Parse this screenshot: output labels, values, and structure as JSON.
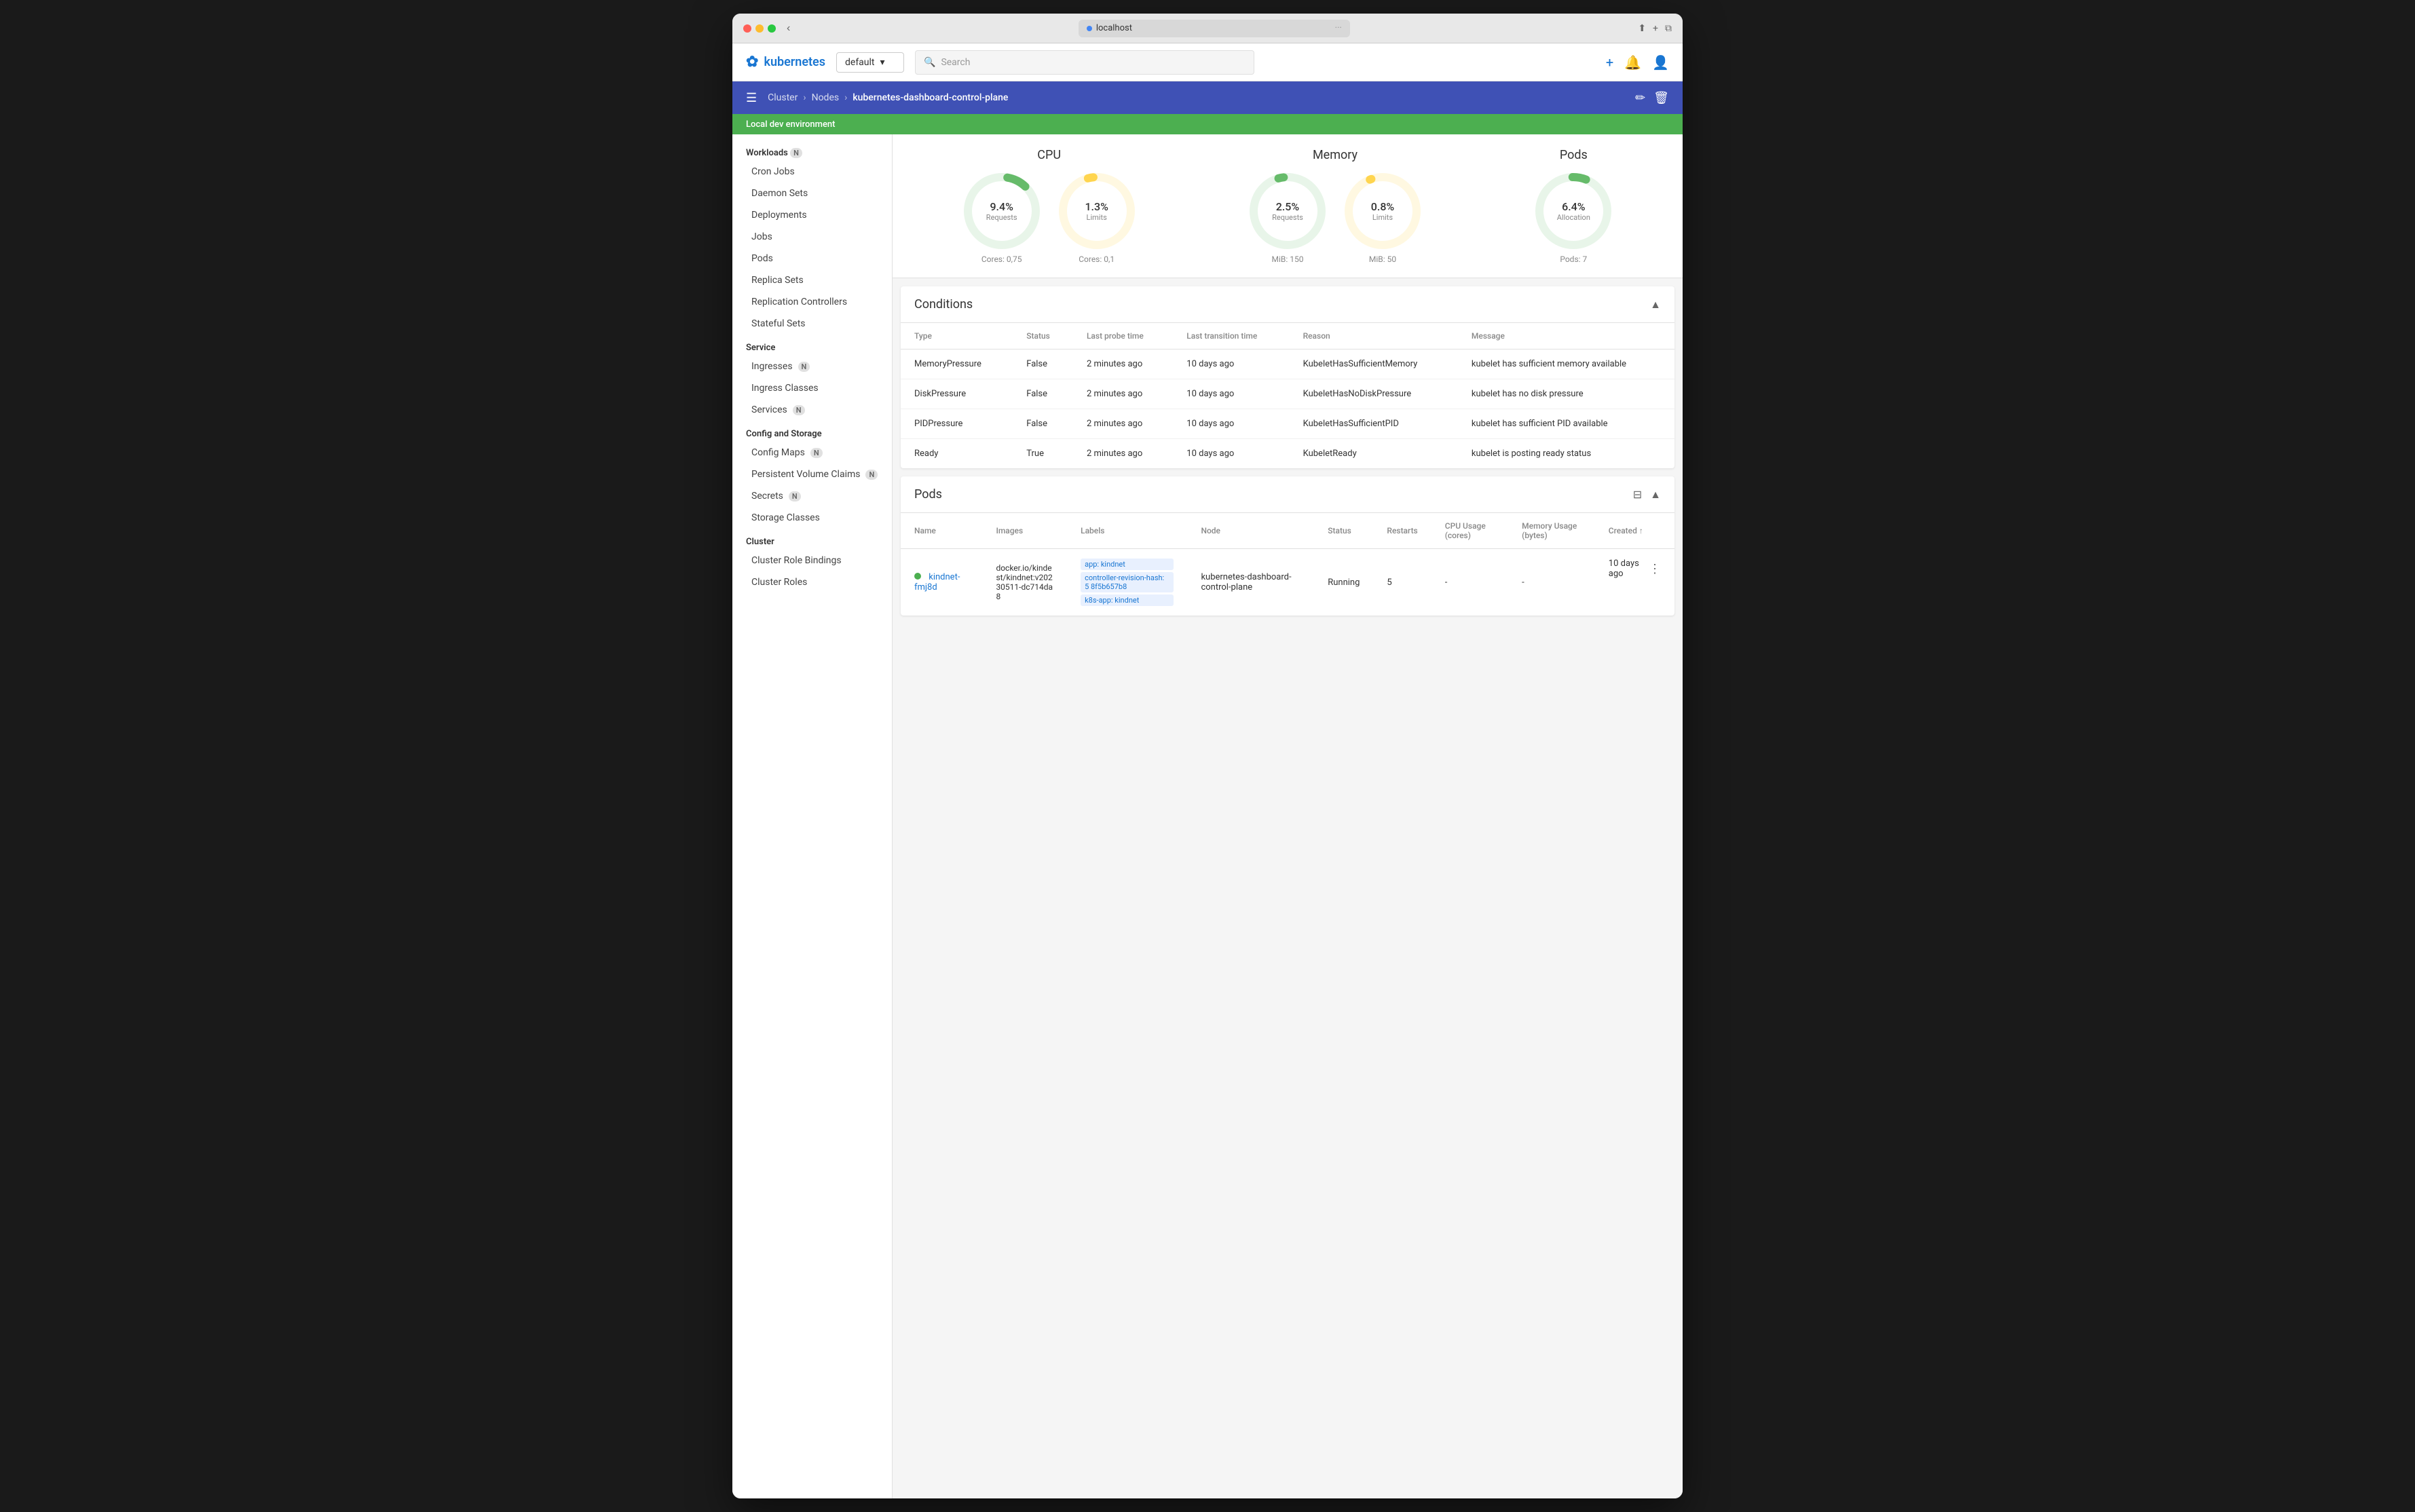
{
  "window": {
    "url": "localhost"
  },
  "topnav": {
    "logo": "kubernetes",
    "namespace": "default",
    "search_placeholder": "Search"
  },
  "breadcrumb": {
    "cluster": "Cluster",
    "nodes": "Nodes",
    "current": "kubernetes-dashboard-control-plane"
  },
  "env_banner": "Local dev environment",
  "sidebar": {
    "workloads_label": "Workloads",
    "workloads_badge": "N",
    "items_workloads": [
      {
        "label": "Cron Jobs",
        "badge": null
      },
      {
        "label": "Daemon Sets",
        "badge": null
      },
      {
        "label": "Deployments",
        "badge": null
      },
      {
        "label": "Jobs",
        "badge": null
      },
      {
        "label": "Pods",
        "badge": null
      },
      {
        "label": "Replica Sets",
        "badge": null
      },
      {
        "label": "Replication Controllers",
        "badge": null
      },
      {
        "label": "Stateful Sets",
        "badge": null
      }
    ],
    "service_label": "Service",
    "items_service": [
      {
        "label": "Ingresses",
        "badge": "N"
      },
      {
        "label": "Ingress Classes",
        "badge": null
      },
      {
        "label": "Services",
        "badge": "N"
      }
    ],
    "config_label": "Config and Storage",
    "items_config": [
      {
        "label": "Config Maps",
        "badge": "N"
      },
      {
        "label": "Persistent Volume Claims",
        "badge": "N"
      },
      {
        "label": "Secrets",
        "badge": "N"
      },
      {
        "label": "Storage Classes",
        "badge": null
      }
    ],
    "cluster_label": "Cluster",
    "items_cluster": [
      {
        "label": "Cluster Role Bindings",
        "badge": null
      },
      {
        "label": "Cluster Roles",
        "badge": null
      }
    ]
  },
  "cpu": {
    "title": "CPU",
    "requests_pct": "9.4%",
    "requests_label": "Requests",
    "requests_bottom": "Cores: 0,75",
    "limits_pct": "1.3%",
    "limits_label": "Limits",
    "limits_bottom": "Cores: 0,1"
  },
  "memory": {
    "title": "Memory",
    "requests_pct": "2.5%",
    "requests_label": "Requests",
    "requests_bottom": "MiB: 150",
    "limits_pct": "0.8%",
    "limits_label": "Limits",
    "limits_bottom": "MiB: 50"
  },
  "pods_chart": {
    "title": "Pods",
    "allocation_pct": "6.4%",
    "allocation_label": "Allocation",
    "allocation_bottom": "Pods: 7"
  },
  "conditions": {
    "title": "Conditions",
    "columns": [
      "Type",
      "Status",
      "Last probe time",
      "Last transition time",
      "Reason",
      "Message"
    ],
    "rows": [
      {
        "type": "MemoryPressure",
        "status": "False",
        "last_probe": "2 minutes ago",
        "last_transition": "10 days ago",
        "reason": "KubeletHasSufficientMemory",
        "message": "kubelet has sufficient memory available"
      },
      {
        "type": "DiskPressure",
        "status": "False",
        "last_probe": "2 minutes ago",
        "last_transition": "10 days ago",
        "reason": "KubeletHasNoDiskPressure",
        "message": "kubelet has no disk pressure"
      },
      {
        "type": "PIDPressure",
        "status": "False",
        "last_probe": "2 minutes ago",
        "last_transition": "10 days ago",
        "reason": "KubeletHasSufficientPID",
        "message": "kubelet has sufficient PID available"
      },
      {
        "type": "Ready",
        "status": "True",
        "last_probe": "2 minutes ago",
        "last_transition": "10 days ago",
        "reason": "KubeletReady",
        "message": "kubelet is posting ready status"
      }
    ]
  },
  "pods_table": {
    "title": "Pods",
    "columns": [
      "Name",
      "Images",
      "Labels",
      "Node",
      "Status",
      "Restarts",
      "CPU Usage (cores)",
      "Memory Usage (bytes)",
      "Created ↑"
    ],
    "rows": [
      {
        "status_color": "#4caf50",
        "name": "kindnet-fmj8d",
        "image": "docker.io/kindest/kindnet:v20230511-dc714da8",
        "labels": [
          "app: kindnet",
          "controller-revision-hash: 5 8f5b657b8",
          "k8s-app: kindnet"
        ],
        "node": "kubernetes-dashboard-control-plane",
        "status": "Running",
        "restarts": "5",
        "cpu": "-",
        "memory": "-",
        "created": "10 days ago"
      }
    ]
  }
}
